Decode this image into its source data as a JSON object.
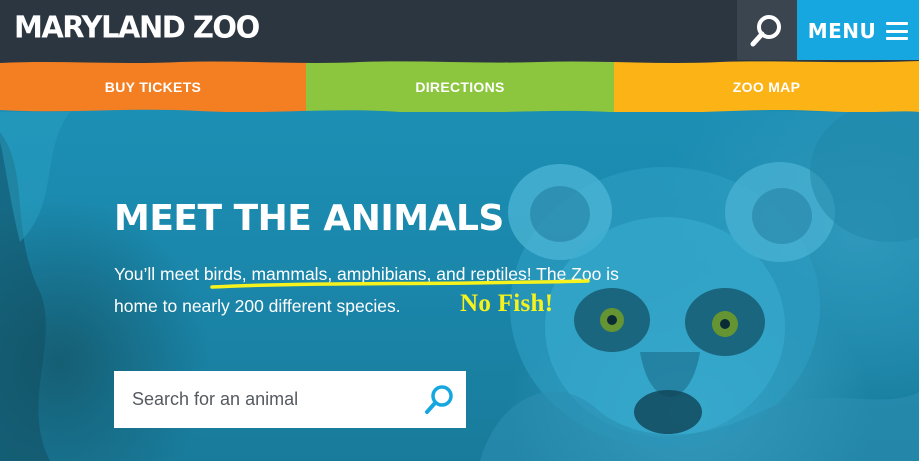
{
  "header": {
    "logo": "MARYLAND ZOO",
    "search_icon": "search-icon",
    "menu_label": "MENU",
    "menu_icon": "hamburger-icon"
  },
  "nav": {
    "items": [
      {
        "label": "BUY TICKETS",
        "color": "#f47f22"
      },
      {
        "label": "DIRECTIONS",
        "color": "#8cc63e"
      },
      {
        "label": "ZOO MAP",
        "color": "#fbb316"
      }
    ]
  },
  "hero": {
    "title": "MEET THE ANIMALS",
    "body_line1": "You’ll meet birds, mammals, amphibians, and reptiles! The Zoo is",
    "body_line2": "home to nearly 200 different species.",
    "annotation": "No Fish!",
    "annotation_color": "#f5f21e",
    "search_placeholder": "Search for an animal",
    "search_icon": "magnifier-icon"
  },
  "colors": {
    "header_bg": "#2c3640",
    "menu_bg": "#16a6e0",
    "hero_bg": "#1c8fb4"
  }
}
